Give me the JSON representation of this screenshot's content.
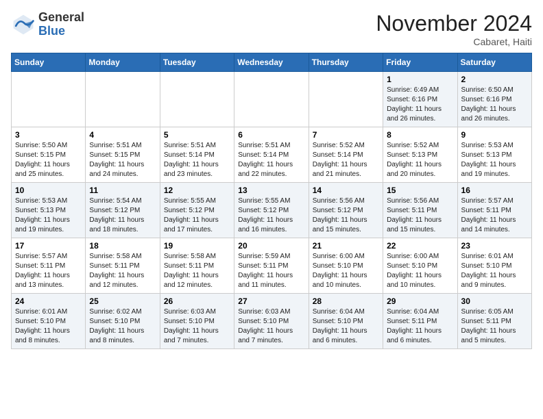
{
  "logo": {
    "general": "General",
    "blue": "Blue"
  },
  "header": {
    "month": "November 2024",
    "location": "Cabaret, Haiti"
  },
  "days_of_week": [
    "Sunday",
    "Monday",
    "Tuesday",
    "Wednesday",
    "Thursday",
    "Friday",
    "Saturday"
  ],
  "weeks": [
    [
      {
        "day": "",
        "info": ""
      },
      {
        "day": "",
        "info": ""
      },
      {
        "day": "",
        "info": ""
      },
      {
        "day": "",
        "info": ""
      },
      {
        "day": "",
        "info": ""
      },
      {
        "day": "1",
        "info": "Sunrise: 6:49 AM\nSunset: 6:16 PM\nDaylight: 11 hours\nand 26 minutes."
      },
      {
        "day": "2",
        "info": "Sunrise: 6:50 AM\nSunset: 6:16 PM\nDaylight: 11 hours\nand 26 minutes."
      }
    ],
    [
      {
        "day": "3",
        "info": "Sunrise: 5:50 AM\nSunset: 5:15 PM\nDaylight: 11 hours\nand 25 minutes."
      },
      {
        "day": "4",
        "info": "Sunrise: 5:51 AM\nSunset: 5:15 PM\nDaylight: 11 hours\nand 24 minutes."
      },
      {
        "day": "5",
        "info": "Sunrise: 5:51 AM\nSunset: 5:14 PM\nDaylight: 11 hours\nand 23 minutes."
      },
      {
        "day": "6",
        "info": "Sunrise: 5:51 AM\nSunset: 5:14 PM\nDaylight: 11 hours\nand 22 minutes."
      },
      {
        "day": "7",
        "info": "Sunrise: 5:52 AM\nSunset: 5:14 PM\nDaylight: 11 hours\nand 21 minutes."
      },
      {
        "day": "8",
        "info": "Sunrise: 5:52 AM\nSunset: 5:13 PM\nDaylight: 11 hours\nand 20 minutes."
      },
      {
        "day": "9",
        "info": "Sunrise: 5:53 AM\nSunset: 5:13 PM\nDaylight: 11 hours\nand 19 minutes."
      }
    ],
    [
      {
        "day": "10",
        "info": "Sunrise: 5:53 AM\nSunset: 5:13 PM\nDaylight: 11 hours\nand 19 minutes."
      },
      {
        "day": "11",
        "info": "Sunrise: 5:54 AM\nSunset: 5:12 PM\nDaylight: 11 hours\nand 18 minutes."
      },
      {
        "day": "12",
        "info": "Sunrise: 5:55 AM\nSunset: 5:12 PM\nDaylight: 11 hours\nand 17 minutes."
      },
      {
        "day": "13",
        "info": "Sunrise: 5:55 AM\nSunset: 5:12 PM\nDaylight: 11 hours\nand 16 minutes."
      },
      {
        "day": "14",
        "info": "Sunrise: 5:56 AM\nSunset: 5:12 PM\nDaylight: 11 hours\nand 15 minutes."
      },
      {
        "day": "15",
        "info": "Sunrise: 5:56 AM\nSunset: 5:11 PM\nDaylight: 11 hours\nand 15 minutes."
      },
      {
        "day": "16",
        "info": "Sunrise: 5:57 AM\nSunset: 5:11 PM\nDaylight: 11 hours\nand 14 minutes."
      }
    ],
    [
      {
        "day": "17",
        "info": "Sunrise: 5:57 AM\nSunset: 5:11 PM\nDaylight: 11 hours\nand 13 minutes."
      },
      {
        "day": "18",
        "info": "Sunrise: 5:58 AM\nSunset: 5:11 PM\nDaylight: 11 hours\nand 12 minutes."
      },
      {
        "day": "19",
        "info": "Sunrise: 5:58 AM\nSunset: 5:11 PM\nDaylight: 11 hours\nand 12 minutes."
      },
      {
        "day": "20",
        "info": "Sunrise: 5:59 AM\nSunset: 5:11 PM\nDaylight: 11 hours\nand 11 minutes."
      },
      {
        "day": "21",
        "info": "Sunrise: 6:00 AM\nSunset: 5:10 PM\nDaylight: 11 hours\nand 10 minutes."
      },
      {
        "day": "22",
        "info": "Sunrise: 6:00 AM\nSunset: 5:10 PM\nDaylight: 11 hours\nand 10 minutes."
      },
      {
        "day": "23",
        "info": "Sunrise: 6:01 AM\nSunset: 5:10 PM\nDaylight: 11 hours\nand 9 minutes."
      }
    ],
    [
      {
        "day": "24",
        "info": "Sunrise: 6:01 AM\nSunset: 5:10 PM\nDaylight: 11 hours\nand 8 minutes."
      },
      {
        "day": "25",
        "info": "Sunrise: 6:02 AM\nSunset: 5:10 PM\nDaylight: 11 hours\nand 8 minutes."
      },
      {
        "day": "26",
        "info": "Sunrise: 6:03 AM\nSunset: 5:10 PM\nDaylight: 11 hours\nand 7 minutes."
      },
      {
        "day": "27",
        "info": "Sunrise: 6:03 AM\nSunset: 5:10 PM\nDaylight: 11 hours\nand 7 minutes."
      },
      {
        "day": "28",
        "info": "Sunrise: 6:04 AM\nSunset: 5:10 PM\nDaylight: 11 hours\nand 6 minutes."
      },
      {
        "day": "29",
        "info": "Sunrise: 6:04 AM\nSunset: 5:11 PM\nDaylight: 11 hours\nand 6 minutes."
      },
      {
        "day": "30",
        "info": "Sunrise: 6:05 AM\nSunset: 5:11 PM\nDaylight: 11 hours\nand 5 minutes."
      }
    ]
  ]
}
